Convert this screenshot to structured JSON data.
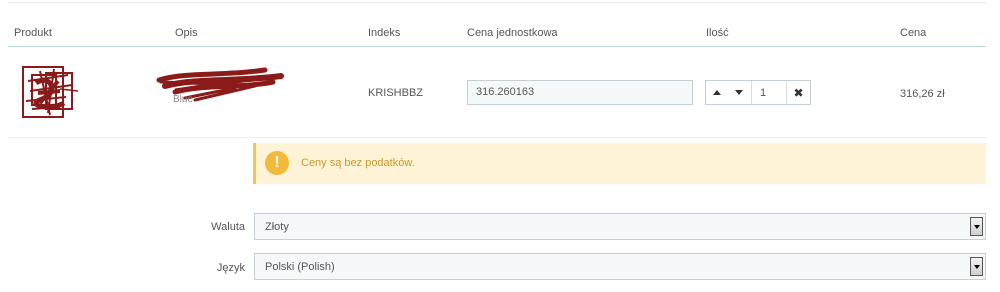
{
  "table": {
    "headers": {
      "product": "Produkt",
      "description": "Opis",
      "index": "Indeks",
      "unit_price": "Cena jednostkowa",
      "quantity": "Ilość",
      "price": "Cena"
    },
    "row": {
      "description_fragment": "Blue",
      "index": "KRISHBBZ",
      "unit_price_value": "316.260163",
      "quantity_value": "1",
      "price": "316,26 zł"
    }
  },
  "alert": {
    "text": "Ceny są bez podatków.",
    "icon": "exclamation-icon",
    "color": "#f3b93a"
  },
  "form": {
    "currency_label": "Waluta",
    "currency_value": "Złoty",
    "language_label": "Język",
    "language_value": "Polski (Polish)"
  },
  "colors": {
    "redaction": "#8b1a1a",
    "header_line": "#b9dbe6",
    "alert_bg": "#fef3d6"
  }
}
